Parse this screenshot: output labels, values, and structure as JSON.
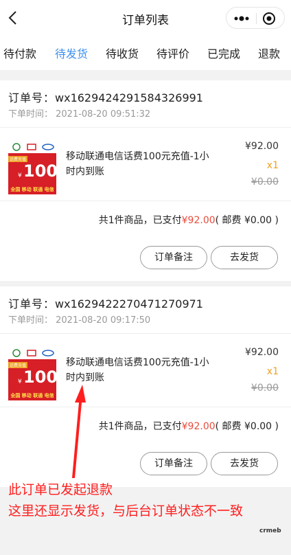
{
  "navbar": {
    "title": "订单列表"
  },
  "tabs": [
    "待付款",
    "待发货",
    "待收货",
    "待评价",
    "已完成",
    "退款"
  ],
  "active_tab": 1,
  "orders": [
    {
      "order_label": "订单号：",
      "order_no": "wx1629424291584326991",
      "time_text": "下单时间：  2021-08-20 09:51:32",
      "goods_name": "移动联通电信话费100元充值-1小时内到账",
      "price": "¥92.00",
      "qty": "x1",
      "original_price": "¥0.00",
      "summary_prefix": "共1件商品，已支付",
      "summary_paid": "¥92.00",
      "summary_suffix": "( 邮费 ¥0.00 )",
      "btn_note": "订单备注",
      "btn_ship": "去发货",
      "thumb": {
        "tag": "话费充值",
        "yen": "¥",
        "amount": "100",
        "carriers": "全国 移动 联通 电信"
      }
    },
    {
      "order_label": "订单号：",
      "order_no": "wx1629422270471270971",
      "time_text": "下单时间：  2021-08-20 09:17:50",
      "goods_name": "移动联通电信话费100元充值-1小时内到账",
      "price": "¥92.00",
      "qty": "x1",
      "original_price": "¥0.00",
      "summary_prefix": "共1件商品，已支付",
      "summary_paid": "¥92.00",
      "summary_suffix": "( 邮费 ¥0.00 )",
      "btn_note": "订单备注",
      "btn_ship": "去发货",
      "thumb": {
        "tag": "话费充值",
        "yen": "¥",
        "amount": "100",
        "carriers": "全国 移动 联通 电信"
      }
    }
  ],
  "annotation": {
    "line1": "此订单已发起退款",
    "line2": "这里还显示发货，与后台订单状态不一致",
    "color": "#ff1e1e"
  },
  "watermark": "crmeb",
  "colors": {
    "accent": "#3d8ff2",
    "price_red": "#e94c3b",
    "qty_orange": "#f0a020"
  }
}
